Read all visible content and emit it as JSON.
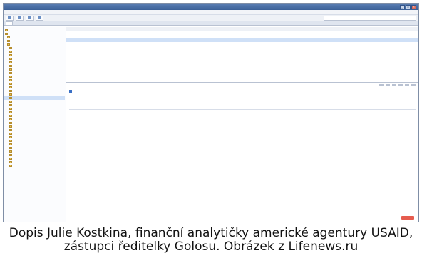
{
  "window": {
    "title": "",
    "buttons": [
      "_",
      "□",
      "×"
    ]
  },
  "menubar": {
    "items": [
      "",
      "",
      "",
      "",
      "",
      ""
    ]
  },
  "toolbar": {
    "buttons": [
      "",
      "",
      "",
      ""
    ],
    "search_placeholder": ""
  },
  "tabs": [
    ""
  ],
  "sidebar": {
    "folders": [
      "",
      "",
      "",
      "",
      "",
      "",
      "",
      "",
      "",
      "",
      "",
      "",
      "",
      "",
      "",
      "",
      "",
      "",
      "",
      "",
      "",
      "",
      "",
      "",
      "",
      "",
      "",
      "",
      "",
      "",
      "",
      "",
      "",
      "",
      "",
      "",
      "",
      "",
      ""
    ]
  },
  "message_list": {
    "columns": [
      "",
      "",
      ""
    ],
    "rows": [
      {
        "subject": "",
        "from": "",
        "date": ""
      },
      {
        "subject": "",
        "from": "",
        "date": ""
      },
      {
        "subject": "",
        "from": "",
        "date": ""
      },
      {
        "subject": "",
        "from": "",
        "date": ""
      }
    ]
  },
  "preview": {
    "subject": "",
    "header_lines": [
      "",
      "",
      ""
    ],
    "actions": [
      "",
      "",
      "",
      "",
      "",
      ""
    ],
    "greeting": "",
    "paragraphs": [
      "",
      "",
      "",
      "",
      "",
      "",
      "",
      "",
      "",
      "",
      "",
      "",
      "",
      ""
    ]
  },
  "caption": "Dopis Julie Kostkina, finanční analytičky americké agentury USAID, zástupci ředitelky Golosu. Obrázek z Lifenews.ru",
  "colors": {
    "selection": "#cfe0f7",
    "highlight": "#3a6fc4",
    "titlebar": "#3a5f96",
    "folder": "#e8c25a",
    "badge": "#e65c4f"
  }
}
